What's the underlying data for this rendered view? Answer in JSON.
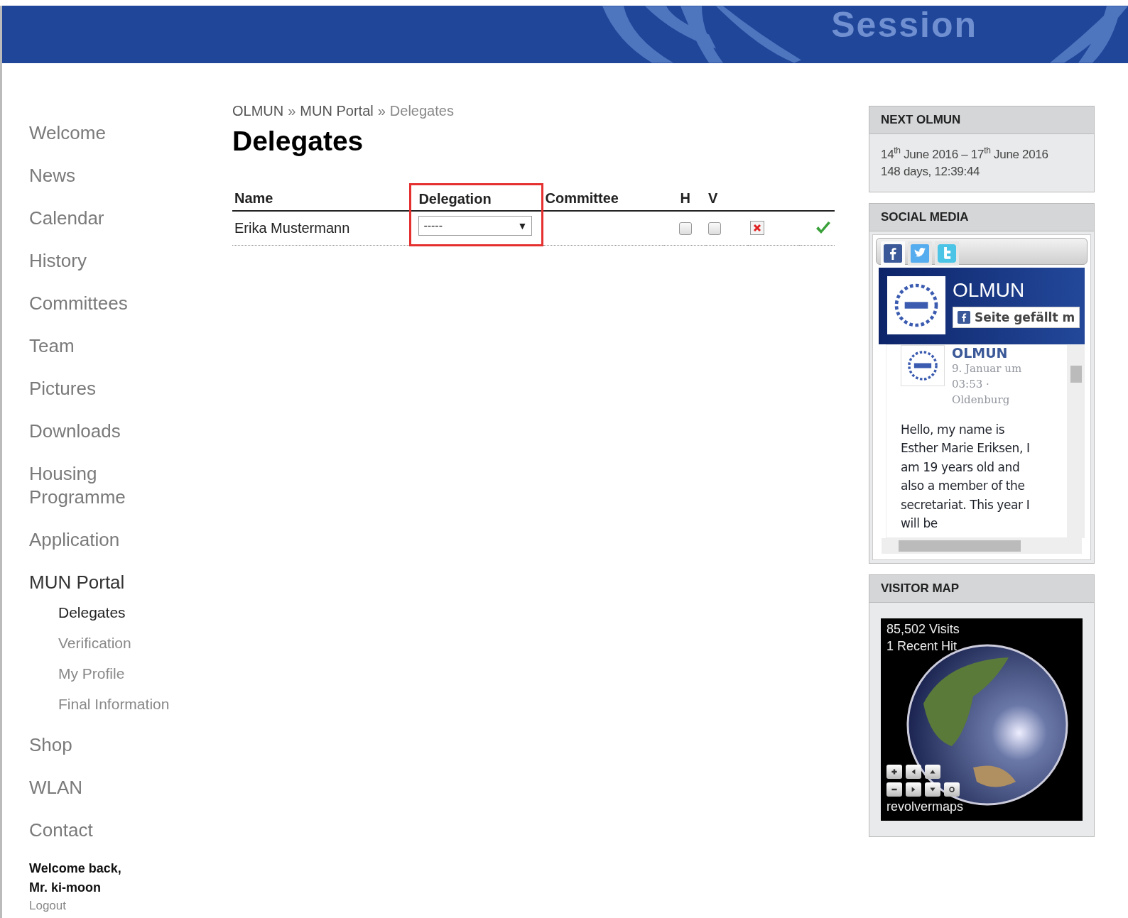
{
  "header": {
    "title": "Session"
  },
  "nav": [
    {
      "label": "Welcome",
      "selected": false
    },
    {
      "label": "News",
      "selected": false
    },
    {
      "label": "Calendar",
      "selected": false
    },
    {
      "label": "History",
      "selected": false
    },
    {
      "label": "Committees",
      "selected": false
    },
    {
      "label": "Team",
      "selected": false
    },
    {
      "label": "Pictures",
      "selected": false
    },
    {
      "label": "Downloads",
      "selected": false
    },
    {
      "label": "Housing Programme",
      "selected": false
    },
    {
      "label": "Application",
      "selected": false
    },
    {
      "label": "MUN Portal",
      "selected": true,
      "children": [
        {
          "label": "Delegates",
          "selected": true
        },
        {
          "label": "Verification",
          "selected": false
        },
        {
          "label": "My Profile",
          "selected": false
        },
        {
          "label": "Final Information",
          "selected": false
        }
      ]
    },
    {
      "label": "Shop",
      "selected": false
    },
    {
      "label": "WLAN",
      "selected": false
    },
    {
      "label": "Contact",
      "selected": false
    }
  ],
  "user": {
    "greeting": "Welcome back,",
    "name": "Mr. ki-moon",
    "logout": "Logout"
  },
  "breadcrumb": [
    "OLMUN",
    "MUN Portal",
    "Delegates"
  ],
  "breadcrumb_separator": "»",
  "page_title": "Delegates",
  "table": {
    "columns": [
      {
        "label": "Name",
        "highlighted": false
      },
      {
        "label": "Delegation",
        "highlighted": true
      },
      {
        "label": "Committee",
        "highlighted": false
      },
      {
        "label": "H",
        "highlighted": false
      },
      {
        "label": "V",
        "highlighted": false
      }
    ],
    "rows": [
      {
        "name": "Erika Mustermann",
        "delegation": "-----",
        "delegation_arrow": "▼",
        "h_checked": false,
        "v_checked": false
      }
    ]
  },
  "next_olmun": {
    "title": "NEXT OLMUN",
    "dates": "14$^{th}$ June 2016  –  17$^{th}$ June 2016",
    "countdown": "148 days, 12:39:44"
  },
  "social": {
    "title": "SOCIAL MEDIA",
    "tabs": [
      {
        "kind": "facebook",
        "selected": true
      },
      {
        "kind": "twitter",
        "selected": false
      },
      {
        "kind": "twitter-old",
        "selected": false
      }
    ],
    "page_name": "OLMUN",
    "like_button": "Seite gefällt m",
    "post": {
      "author": "OLMUN",
      "meta": "9. Januar um 03:53 · Oldenburg",
      "body": "Hello, my name is Esther Marie Eriksen, I am 19 years old and also a member of the secretariat. This year I will be"
    }
  },
  "visitor_map": {
    "title": "VISITOR MAP",
    "visits": "85,502 Visits",
    "recent": "1 Recent Hit",
    "brand": "revolvermaps"
  }
}
